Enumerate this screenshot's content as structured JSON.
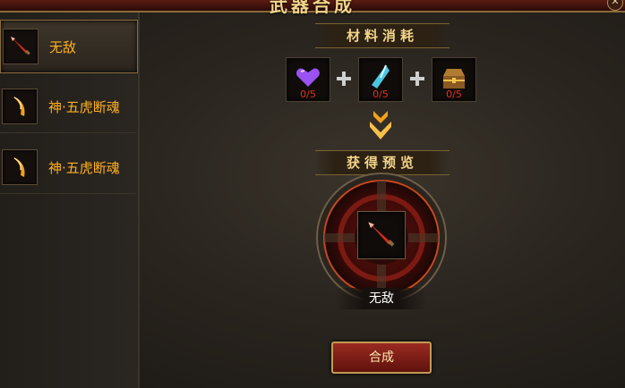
{
  "window": {
    "title": "武器合成",
    "close_icon": "close-icon"
  },
  "sidebar": {
    "items": [
      {
        "label": "无敌",
        "icon": "red-sword-icon",
        "selected": true
      },
      {
        "label": "神·五虎断魂",
        "icon": "golden-blade-icon",
        "selected": false
      },
      {
        "label": "神·五虎断魂",
        "icon": "golden-blade-icon",
        "selected": false
      }
    ]
  },
  "materials": {
    "header": "材料消耗",
    "slots": [
      {
        "icon": "purple-heart-gem-icon",
        "count": "0/5"
      },
      {
        "icon": "blue-crystal-icon",
        "count": "0/5"
      },
      {
        "icon": "treasure-chest-icon",
        "count": "0/5"
      }
    ]
  },
  "preview": {
    "header": "获得预览",
    "item_name": "无敌",
    "icon": "red-sword-icon"
  },
  "actions": {
    "craft_label": "合成"
  },
  "colors": {
    "accent_gold": "#f3d58a",
    "item_orange": "#ffb020",
    "count_red": "#e33020",
    "button_red": "#9a2a20"
  }
}
